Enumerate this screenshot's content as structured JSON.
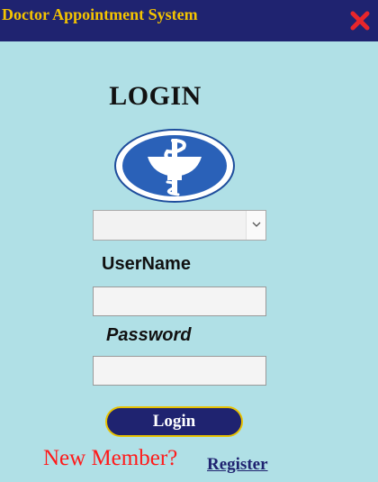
{
  "window": {
    "title": "Doctor Appointment System",
    "close_icon": "close-x-icon",
    "colors": {
      "titlebar_bg": "#1f2370",
      "title_text": "#f5c400",
      "close": "#e8262b",
      "page_bg": "#b0e0e6"
    }
  },
  "login": {
    "heading": "LOGIN",
    "logo_icon": "medical-caduceus-logo",
    "role_select": {
      "selected": "",
      "icon": "chevron-down-icon"
    },
    "username_label": "UserName",
    "username_value": "",
    "password_label": "Password",
    "password_value": "",
    "submit_label": "Login",
    "new_member_text": "New Member?",
    "register_label": "Register"
  }
}
